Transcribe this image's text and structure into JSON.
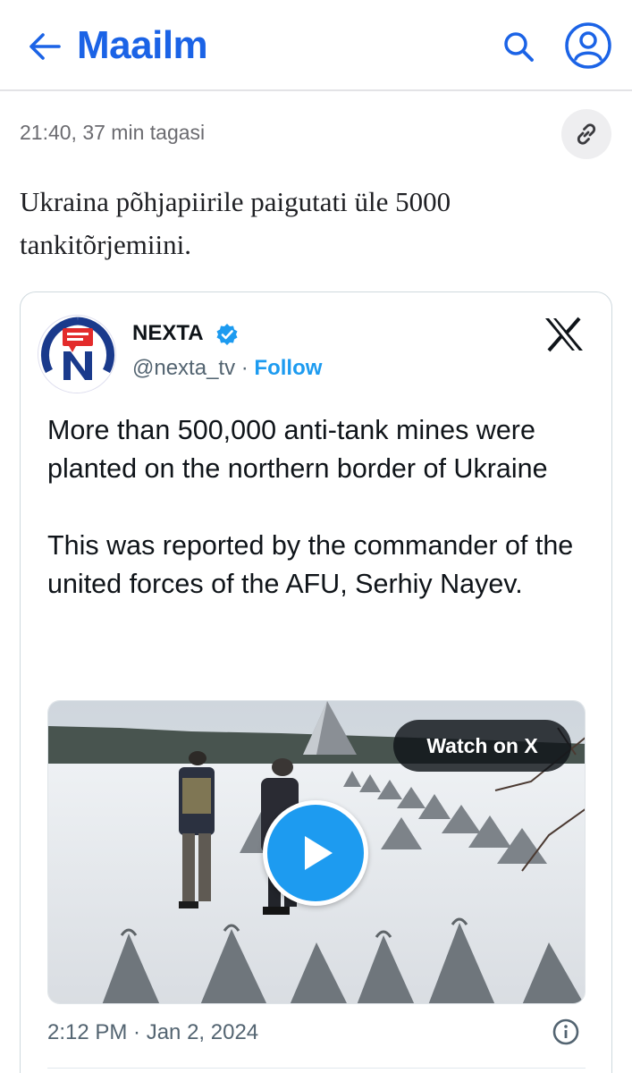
{
  "header": {
    "title": "Maailm",
    "back_icon": "arrow-left-icon",
    "search_icon": "search-icon",
    "account_icon": "user-circle-icon",
    "accent_color": "#1b63e6"
  },
  "article": {
    "timestamp": "21:40, 37 min tagasi",
    "link_icon": "link-icon",
    "text": "Ukraina põhjapiirile paigutati üle 5000 tankitõrjemiini."
  },
  "tweet": {
    "author_name": "NEXTA",
    "verified_icon": "verified-badge-icon",
    "handle": "@nexta_tv",
    "separator": " · ",
    "follow_label": "Follow",
    "platform_icon": "x-logo-icon",
    "text": "More than 500,000 anti-tank mines were planted on the northern border of Ukraine\n\nThis was reported by the commander of the united forces of the AFU, Serhiy Nayev.",
    "media": {
      "watch_label": "Watch on X",
      "play_icon": "play-icon"
    },
    "date": "2:12 PM · Jan 2, 2024",
    "info_icon": "info-icon",
    "link_color": "#1d9bf0"
  }
}
